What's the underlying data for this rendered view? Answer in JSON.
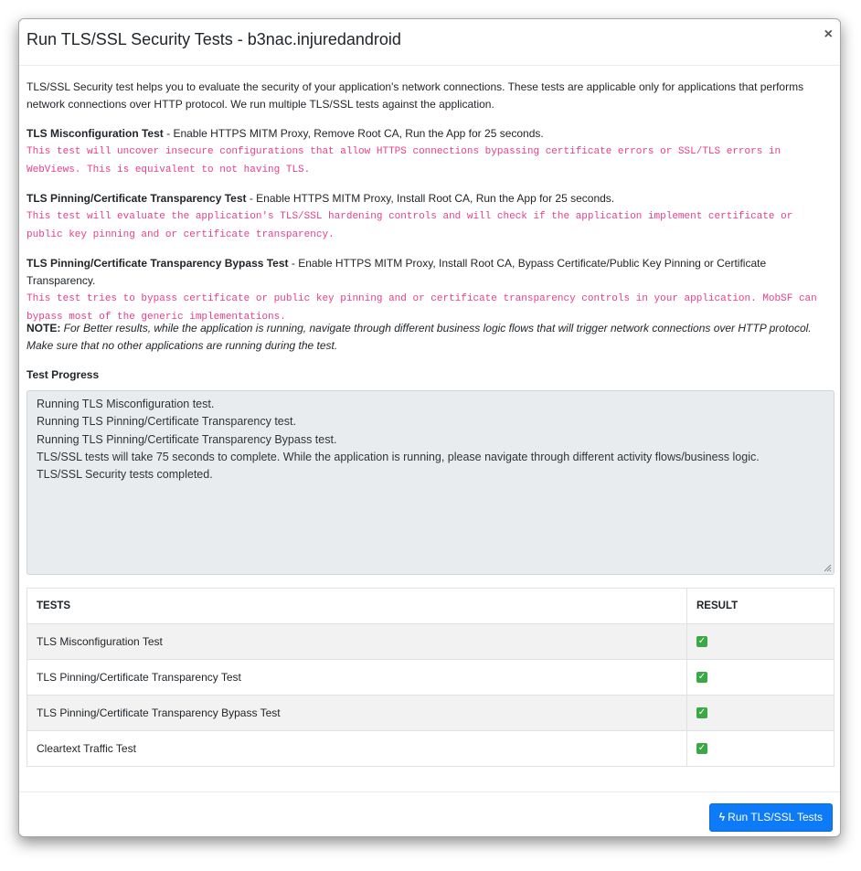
{
  "modal": {
    "title": "Run TLS/SSL Security Tests - b3nac.injuredandroid",
    "close_label": "×"
  },
  "intro": "TLS/SSL Security test helps you to evaluate the security of your application's network connections. These tests are applicable only for applications that performs network connections over HTTP protocol. We run multiple TLS/SSL tests against the application.",
  "sections": [
    {
      "name": "TLS Misconfiguration Test",
      "steps": " - Enable HTTPS MITM Proxy, Remove Root CA, Run the App for 25 seconds.",
      "description": "This test will uncover insecure configurations that allow HTTPS connections bypassing certificate errors or SSL/TLS errors in WebViews. This is equivalent to not having TLS."
    },
    {
      "name": "TLS Pinning/Certificate Transparency Test",
      "steps": " - Enable HTTPS MITM Proxy, Install Root CA, Run the App for 25 seconds.",
      "description": "This test will evaluate the application's TLS/SSL hardening controls and will check if the application implement certificate or public key pinning and or certificate transparency."
    },
    {
      "name": "TLS Pinning/Certificate Transparency Bypass Test",
      "steps": " - Enable HTTPS MITM Proxy, Install Root CA, Bypass Certificate/Public Key Pinning or Certificate Transparency.",
      "description": "This test tries to bypass certificate or public key pinning and or certificate transparency controls in your application. MobSF can bypass most of the generic implementations."
    }
  ],
  "note": {
    "label": "NOTE:",
    "text": " For Better results, while the application is running, navigate through different business logic flows that will trigger network connections over HTTP protocol. Make sure that no other applications are running during the test."
  },
  "progress": {
    "label": "Test Progress",
    "lines": [
      "Running TLS Misconfiguration test.",
      "Running TLS Pinning/Certificate Transparency test.",
      "Running TLS Pinning/Certificate Transparency Bypass test.",
      "TLS/SSL tests will take 75 seconds to complete. While the application is running, please navigate through different activity flows/business logic.",
      "TLS/SSL Security tests completed."
    ]
  },
  "table": {
    "headers": [
      "TESTS",
      "RESULT"
    ],
    "rows": [
      {
        "test": "TLS Misconfiguration Test",
        "result": "✓"
      },
      {
        "test": "TLS Pinning/Certificate Transparency Test",
        "result": "✓"
      },
      {
        "test": "TLS Pinning/Certificate Transparency Bypass Test",
        "result": "✓"
      },
      {
        "test": "Cleartext Traffic Test",
        "result": "✓"
      }
    ]
  },
  "footer": {
    "run_button_icon": "bolt-icon",
    "run_button_label": "Run TLS/SSL Tests"
  },
  "colors": {
    "accent": "#0d7bf7",
    "code_pink": "#e83e8c",
    "success": "#3aa845"
  }
}
